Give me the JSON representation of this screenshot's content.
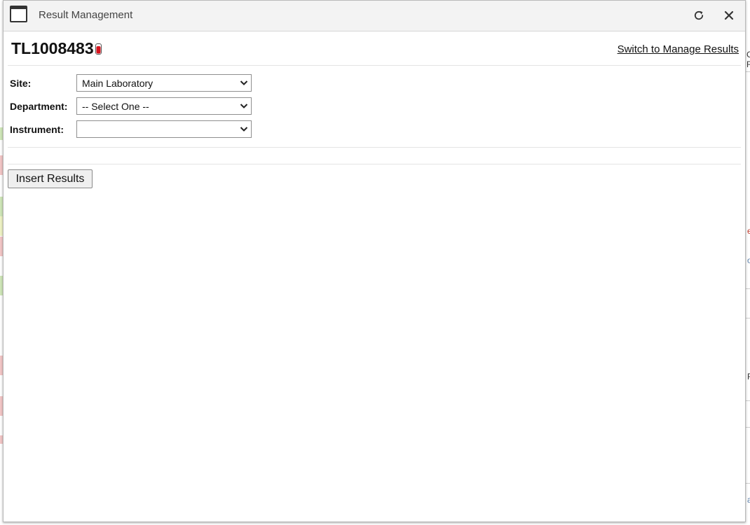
{
  "dialog": {
    "title": "Result Management",
    "window_icon": "window-icon",
    "refresh_icon": "refresh-icon",
    "close_icon": "close-icon"
  },
  "header": {
    "record_id": "TL1008483",
    "tube_icon": "test-tube-icon",
    "tube_color": "#d8141e",
    "switch_link": "Switch to Manage Results"
  },
  "form": {
    "site": {
      "label": "Site:",
      "value": "Main Laboratory"
    },
    "department": {
      "label": "Department:",
      "value": "-- Select One --"
    },
    "instrument": {
      "label": "Instrument:",
      "value": ""
    }
  },
  "actions": {
    "insert_results": "Insert Results"
  },
  "background": {
    "glyphs": [
      "C",
      "R",
      "e",
      "o",
      "F",
      "a"
    ]
  }
}
